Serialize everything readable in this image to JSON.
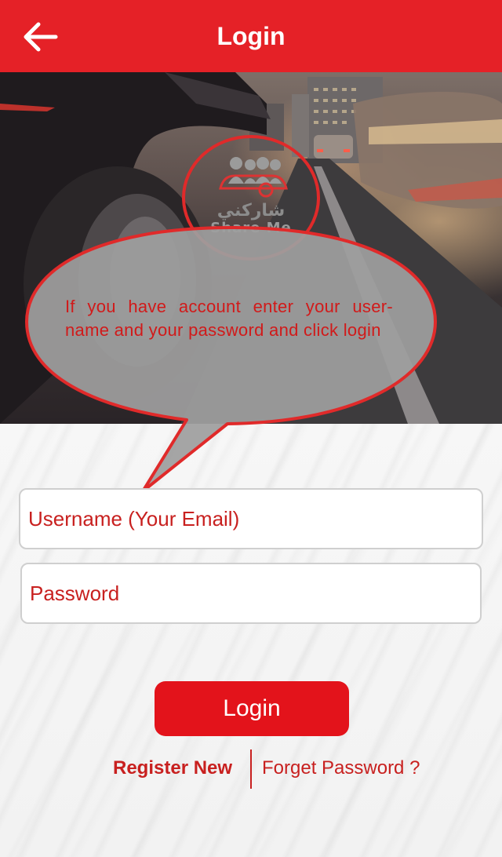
{
  "header": {
    "title": "Login",
    "back_icon": "arrow-left-icon",
    "background": "#e52127"
  },
  "hero": {
    "image": "car-driving-city-street-photo",
    "logo": {
      "arabic_text": "شاركني",
      "latin_text": "Share Me",
      "icon": "carpool-people-car-icon",
      "accent": "#e02a2a"
    }
  },
  "tooltip": {
    "text": "If you have account enter your user-name and your password and click login"
  },
  "form": {
    "username_placeholder": "Username (Your Email)",
    "username_value": "",
    "password_placeholder": "Password",
    "password_value": ""
  },
  "actions": {
    "login_label": "Login",
    "register_label": "Register New",
    "forget_label": "Forget Password ?"
  },
  "colors": {
    "accent": "#e3131b",
    "text_red": "#c8201f"
  }
}
